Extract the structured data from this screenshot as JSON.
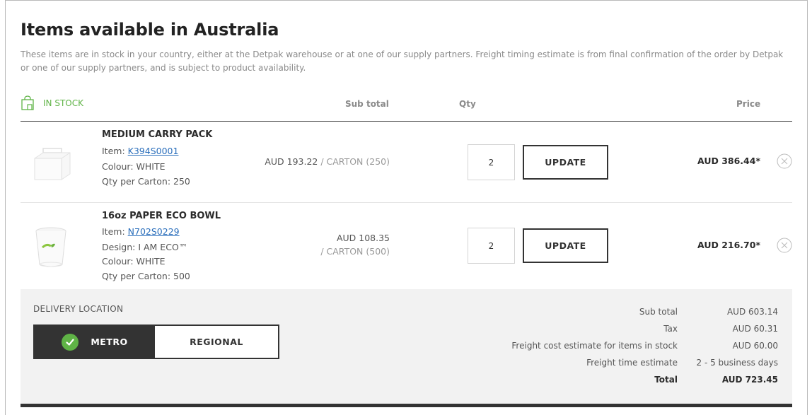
{
  "section": {
    "title": "Items available in Australia",
    "description": "These items are in stock in your country, either at the Detpak warehouse or at one of our supply partners. Freight timing estimate is from final confirmation of the order by Detpak or one of our supply partners, and is subject to product availability."
  },
  "table_header": {
    "stock_icon": "shopping-bag-icon",
    "stock_label": "IN STOCK",
    "subtotal": "Sub total",
    "qty": "Qty",
    "price": "Price"
  },
  "items": [
    {
      "name": "MEDIUM CARRY PACK",
      "item_label": "Item:",
      "item_code": "K394S0001",
      "colour": "Colour: WHITE",
      "qty_per_carton": "Qty per Carton: 250",
      "unit_price": "AUD 193.22",
      "unit": "/ CARTON (250)",
      "qty": "2",
      "update_label": "UPDATE",
      "price": "AUD 386.44*"
    },
    {
      "name": "16oz PAPER ECO BOWL",
      "item_label": "Item:",
      "item_code": "N702S0229",
      "design": "Design: I AM ECO™",
      "colour": "Colour: WHITE",
      "qty_per_carton": "Qty per Carton: 500",
      "unit_price": "AUD 108.35",
      "unit": "/ CARTON (500)",
      "qty": "2",
      "update_label": "UPDATE",
      "price": "AUD 216.70*"
    }
  ],
  "delivery": {
    "label": "DELIVERY LOCATION",
    "options": [
      "METRO",
      "REGIONAL"
    ],
    "selected": "METRO"
  },
  "summary": {
    "rows": [
      {
        "label": "Sub total",
        "value": "AUD 603.14"
      },
      {
        "label": "Tax",
        "value": "AUD 60.31"
      },
      {
        "label": "Freight cost estimate for items in stock",
        "value": "AUD 60.00"
      },
      {
        "label": "Freight time estimate",
        "value": "2 - 5 business days"
      },
      {
        "label": "Total",
        "value": "AUD 723.45"
      }
    ]
  },
  "colors": {
    "accent_green": "#5fb346",
    "link_blue": "#2a6ebb",
    "dark": "#333333"
  }
}
